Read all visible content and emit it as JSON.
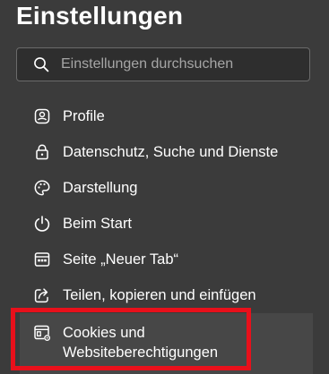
{
  "header": {
    "title": "Einstellungen"
  },
  "search": {
    "placeholder": "Einstellungen durchsuchen",
    "icon": "search-icon"
  },
  "nav": {
    "items": [
      {
        "label": "Profile",
        "icon": "profile-icon"
      },
      {
        "label": "Datenschutz, Suche und Dienste",
        "icon": "lock-icon"
      },
      {
        "label": "Darstellung",
        "icon": "palette-icon"
      },
      {
        "label": "Beim Start",
        "icon": "power-icon"
      },
      {
        "label": "Seite „Neuer Tab“",
        "icon": "new-tab-page-icon"
      },
      {
        "label": "Teilen, kopieren und einfügen",
        "icon": "share-icon"
      },
      {
        "label": "Cookies und Websiteberechtigungen",
        "icon": "cookies-settings-icon",
        "selected": true
      }
    ]
  },
  "colors": {
    "background": "#3b3b3b",
    "selected_background": "#474747",
    "accent": "#a4a4ff",
    "highlight_border": "#e8101b",
    "placeholder": "#a6a6a6"
  }
}
